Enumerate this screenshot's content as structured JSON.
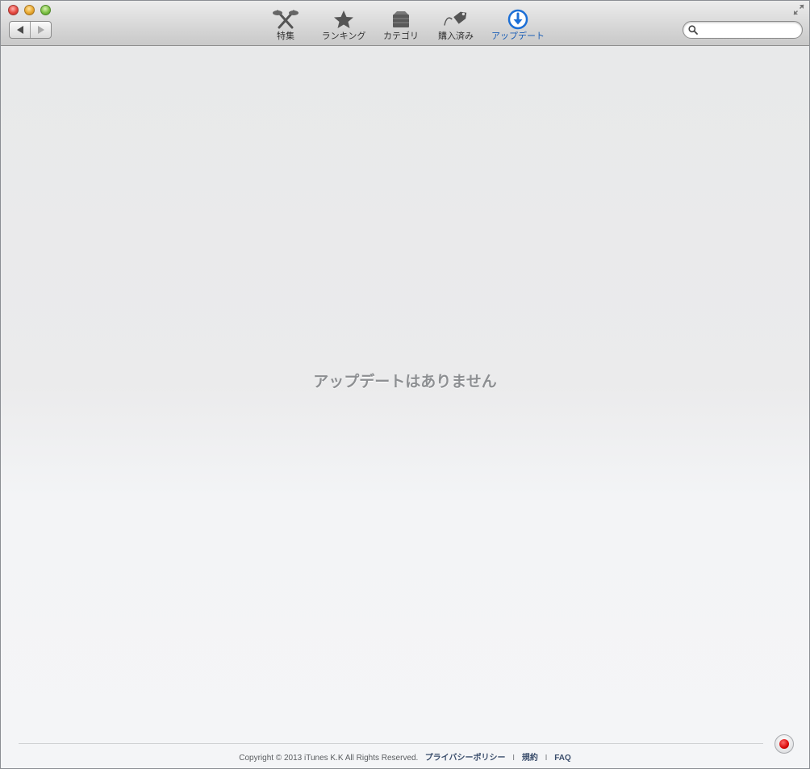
{
  "toolbar": {
    "items": [
      {
        "label": "特集",
        "icon": "featured-icon",
        "active": false
      },
      {
        "label": "ランキング",
        "icon": "star-icon",
        "active": false
      },
      {
        "label": "カテゴリ",
        "icon": "category-box-icon",
        "active": false
      },
      {
        "label": "購入済み",
        "icon": "purchased-tag-icon",
        "active": false
      },
      {
        "label": "アップデート",
        "icon": "update-download-icon",
        "active": true
      }
    ],
    "search": {
      "placeholder": "",
      "value": ""
    },
    "accent_color": "#1c5fb6"
  },
  "main": {
    "empty_message": "アップデートはありません"
  },
  "footer": {
    "copyright": "Copyright © 2013 iTunes K.K All Rights Reserved.",
    "privacy_link": "プライバシーポリシー",
    "terms_link": "規約",
    "faq_link": "FAQ",
    "separator": "I"
  }
}
